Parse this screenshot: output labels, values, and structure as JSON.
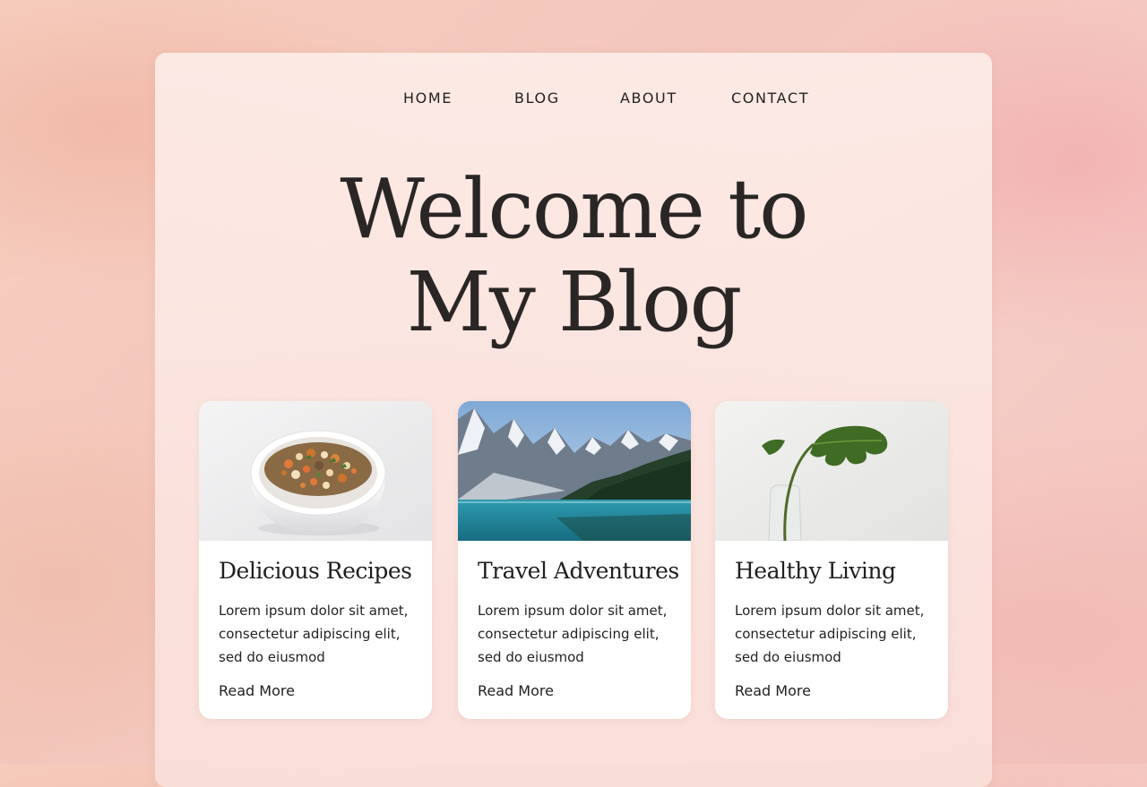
{
  "nav": {
    "items": [
      {
        "label": "HOME"
      },
      {
        "label": "BLOG"
      },
      {
        "label": "ABOUT"
      },
      {
        "label": "CONTACT"
      }
    ]
  },
  "hero": {
    "title": "Welcome to My Blog"
  },
  "cards": [
    {
      "title": "Delicious Recipes",
      "text": "Lorem ipsum dolor sit amet, consectetur adipiscing elit, sed do eiusmod",
      "link": "Read More",
      "image": "bowl-of-food-image"
    },
    {
      "title": "Travel Adventures",
      "text": "Lorem ipsum dolor sit amet, consectetur adipiscing elit, sed do eiusmod",
      "link": "Read More",
      "image": "mountain-lake-image"
    },
    {
      "title": "Healthy Living",
      "text": "Lorem ipsum dolor sit amet, consectetur adipiscing elit, sed do eiusmod",
      "link": "Read More",
      "image": "monstera-leaf-image"
    }
  ],
  "colors": {
    "background": "#f4c9bd",
    "panel": "#fbe6e1",
    "text": "#2a2626",
    "card": "#ffffff"
  }
}
